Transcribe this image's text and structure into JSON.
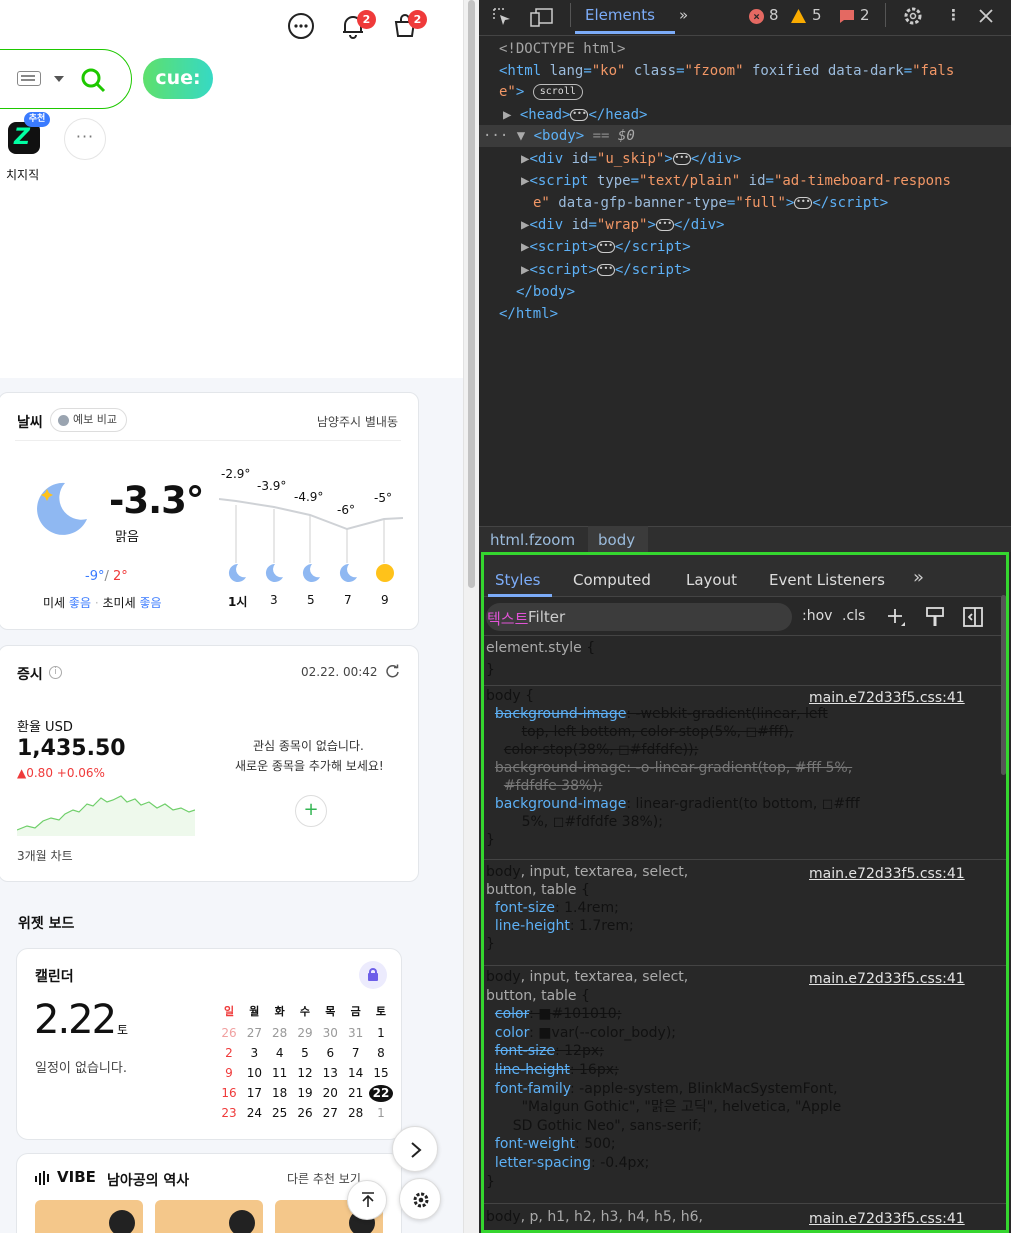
{
  "header": {
    "notif_count": "2",
    "cart_count": "2"
  },
  "search": {
    "cue_label": "cue:"
  },
  "shortcuts": {
    "rec_badge": "추천",
    "chzzk_label": "치지직",
    "more": "···"
  },
  "weather": {
    "title": "날씨",
    "compare": "예보 비교",
    "location": "남양주시 별내동",
    "temp": "-3.3°",
    "condition": "맑음",
    "low": "-9°",
    "slash": "/",
    "high": "2°",
    "dust_label": "미세",
    "dust_val": "좋음",
    "fdust_label": "초미세",
    "fdust_val": "좋음",
    "hourly": [
      {
        "temp": "-2.9°",
        "hour": "1시"
      },
      {
        "temp": "-3.9°",
        "hour": "3"
      },
      {
        "temp": "-4.9°",
        "hour": "5"
      },
      {
        "temp": "-6°",
        "hour": "7"
      },
      {
        "temp": "-5°",
        "hour": "9"
      }
    ]
  },
  "stock": {
    "title": "증시",
    "datetime": "02.22. 00:42",
    "fx_label": "환율 USD",
    "fx_value": "1,435.50",
    "fx_change": "▲0.80 +0.06%",
    "empty1": "관심 종목이 없습니다.",
    "empty2": "새로운 종목을 추가해 보세요!",
    "chart_label": "3개월 차트",
    "add": "+"
  },
  "widget": {
    "title": "위젯 보드",
    "cal_title": "캘린더",
    "date": "2.22",
    "dow": "토",
    "no_events": "일정이 없습니다.",
    "weekdays": [
      "일",
      "월",
      "화",
      "수",
      "목",
      "금",
      "토"
    ],
    "weeks": [
      [
        "26",
        "27",
        "28",
        "29",
        "30",
        "31",
        "1"
      ],
      [
        "2",
        "3",
        "4",
        "5",
        "6",
        "7",
        "8"
      ],
      [
        "9",
        "10",
        "11",
        "12",
        "13",
        "14",
        "15"
      ],
      [
        "16",
        "17",
        "18",
        "19",
        "20",
        "21",
        "22"
      ],
      [
        "23",
        "24",
        "25",
        "26",
        "27",
        "28",
        "1"
      ]
    ],
    "vibe_title": "VIBE",
    "vibe_sub": "남아공의 역사",
    "vibe_more": "다른 추천 보기"
  },
  "devtools": {
    "tab_elements": "Elements",
    "errors": "8",
    "warnings": "5",
    "messages": "2",
    "crumb1": "html.fzoom",
    "crumb2": "body",
    "stabs": [
      "Styles",
      "Computed",
      "Layout",
      "Event Listeners"
    ],
    "filter": "Filter",
    "filter_overlay": "텍스트",
    "hov": ":hov",
    "cls": ".cls",
    "src": "main.e72d33f5.css:41"
  }
}
